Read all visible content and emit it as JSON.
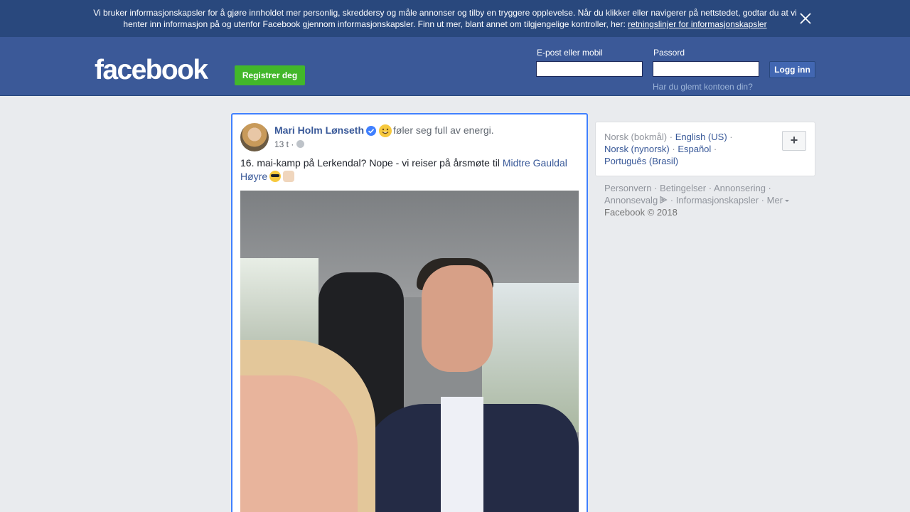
{
  "cookie": {
    "text": "Vi bruker informasjonskapsler for å gjøre innholdet mer personlig, skreddersy og måle annonser og tilby en tryggere opplevelse. Når du klikker eller navigerer på nettstedet, godtar du at vi henter inn informasjon på og utenfor Facebook gjennom informasjonskapsler. Finn ut mer, blant annet om tilgjengelige kontroller, her: ",
    "link": "retningslinjer for informasjonskapsler"
  },
  "header": {
    "logo": "facebook",
    "register_label": "Registrer deg",
    "email_label": "E-post eller mobil",
    "password_label": "Passord",
    "login_label": "Logg inn",
    "forgot_label": "Har du glemt kontoen din?"
  },
  "post": {
    "author": "Mari Holm Lønseth",
    "feeling": "føler seg full av energi.",
    "time": "13 t ·",
    "text": "16. mai-kamp på Lerkendal? Nope - vi reiser på årsmøte til ",
    "mention": "Midtre Gauldal Høyre"
  },
  "languages": {
    "current": "Norsk (bokmål)",
    "en": "English (US)",
    "nn": "Norsk (nynorsk)",
    "es": "Español",
    "pt": "Português (Brasil)",
    "plus": "+"
  },
  "footer": {
    "privacy": "Personvern",
    "terms": "Betingelser",
    "ads": "Annonsering",
    "adchoices": "Annonsevalg",
    "cookies": "Informasjonskapsler",
    "more": "Mer",
    "copyright": "Facebook © 2018"
  },
  "colors": {
    "header": "#3b5998",
    "banner": "#29487d",
    "register": "#42b72a",
    "link": "#385898"
  }
}
